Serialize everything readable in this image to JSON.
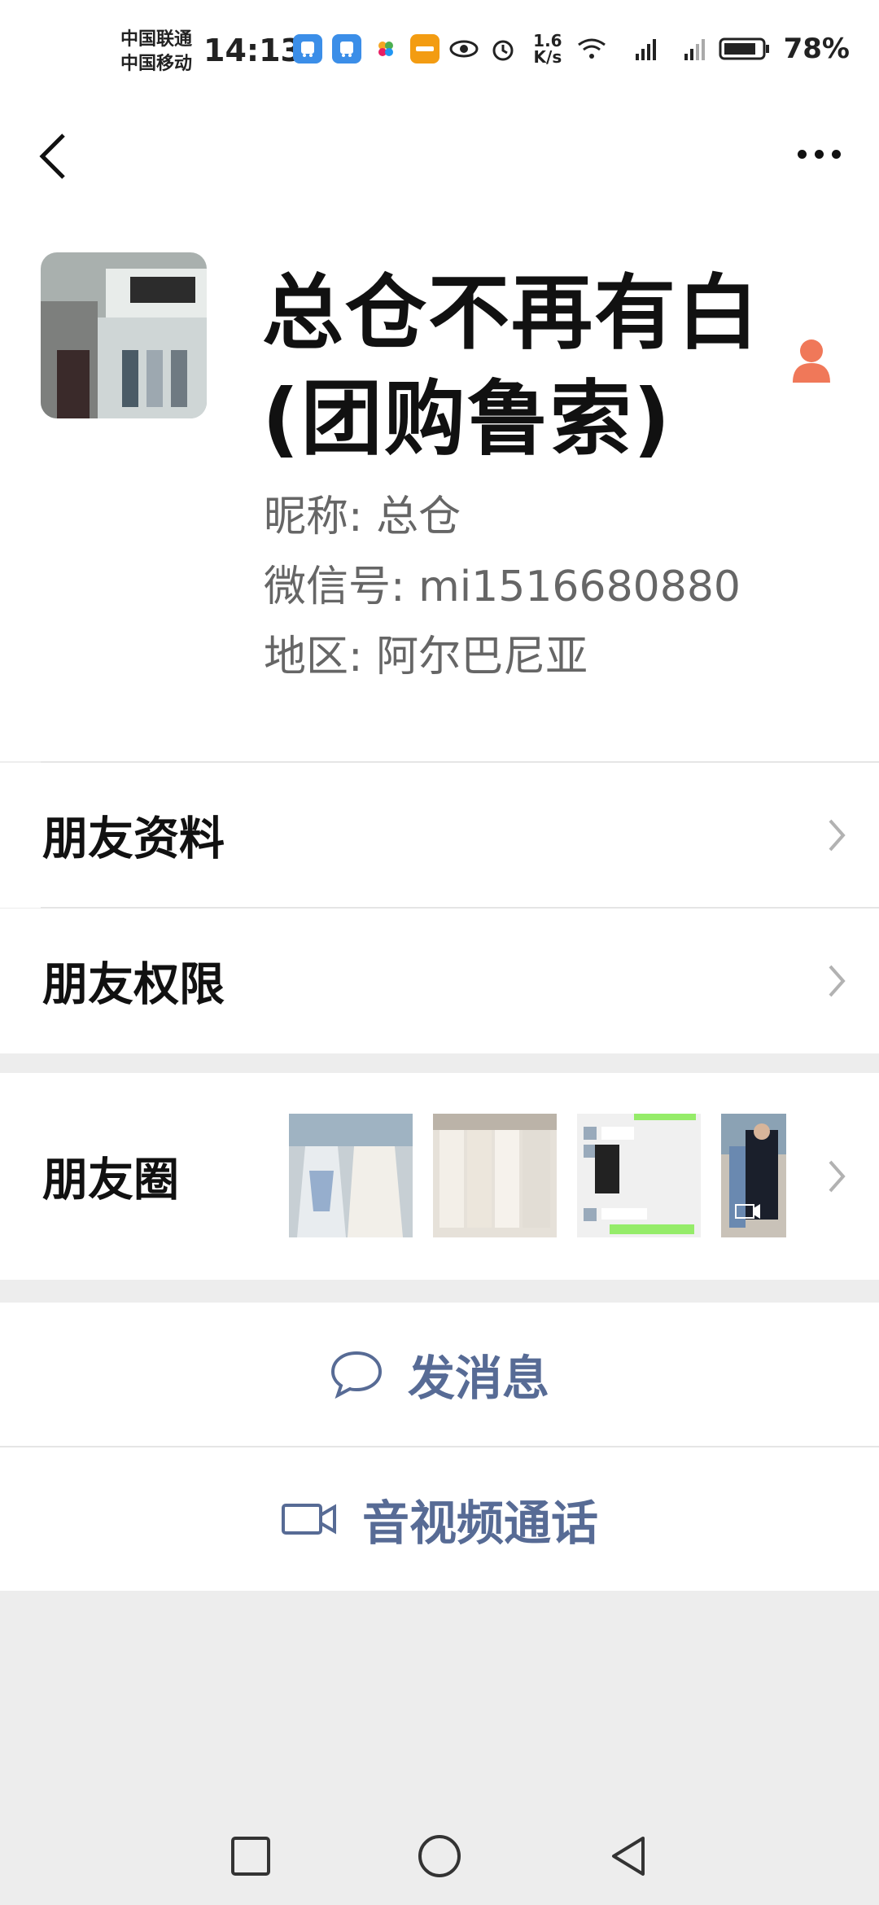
{
  "status_bar": {
    "carrier1": "中国联通",
    "carrier2": "中国移动",
    "time": "14:13",
    "speed": "1.6\nK/s",
    "battery": "78%"
  },
  "profile": {
    "name": "总仓不再有白(团购鲁索)",
    "nickname_label": "昵称:",
    "nickname": "总仓",
    "wechat_id_label": "微信号:",
    "wechat_id": "mi1516680880",
    "region_label": "地区:",
    "region": "阿尔巴尼亚"
  },
  "menu": {
    "friend_info": "朋友资料",
    "friend_permissions": "朋友权限",
    "moments": "朋友圈"
  },
  "actions": {
    "send_message": "发消息",
    "video_call": "音视频通话"
  },
  "colors": {
    "link": "#576b95",
    "background": "#ededed"
  }
}
